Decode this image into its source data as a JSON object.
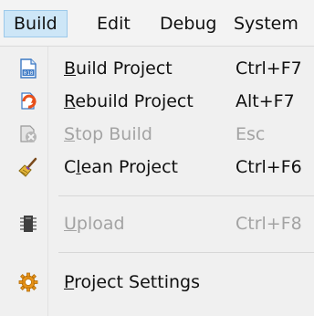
{
  "menubar": {
    "items": [
      {
        "label": "Build",
        "active": true
      },
      {
        "label": "Edit"
      },
      {
        "label": "Debug"
      },
      {
        "label": "System"
      }
    ]
  },
  "dropdown": {
    "items": [
      {
        "pre": "",
        "ul": "B",
        "post": "uild Project",
        "shortcut": "Ctrl+F7",
        "enabled": true,
        "icon": "build-binary-icon"
      },
      {
        "pre": "",
        "ul": "R",
        "post": "ebuild Project",
        "shortcut": "Alt+F7",
        "enabled": true,
        "icon": "rebuild-refresh-icon"
      },
      {
        "pre": "",
        "ul": "S",
        "post": "top Build",
        "shortcut": "Esc",
        "enabled": false,
        "icon": "stop-build-icon"
      },
      {
        "pre": "C",
        "ul": "l",
        "post": "ean Project",
        "shortcut": "Ctrl+F6",
        "enabled": true,
        "icon": "broom-icon"
      },
      {
        "pre": "",
        "ul": "U",
        "post": "pload",
        "shortcut": "Ctrl+F8",
        "enabled": false,
        "icon": "chip-upload-icon"
      },
      {
        "pre": "",
        "ul": "P",
        "post": "roject Settings",
        "shortcut": "",
        "enabled": true,
        "icon": "gear-icon"
      }
    ]
  },
  "colors": {
    "active_menu_bg": "#cde6f7",
    "active_menu_border": "#9cc9ea",
    "disabled_text": "#a3a3a3"
  }
}
